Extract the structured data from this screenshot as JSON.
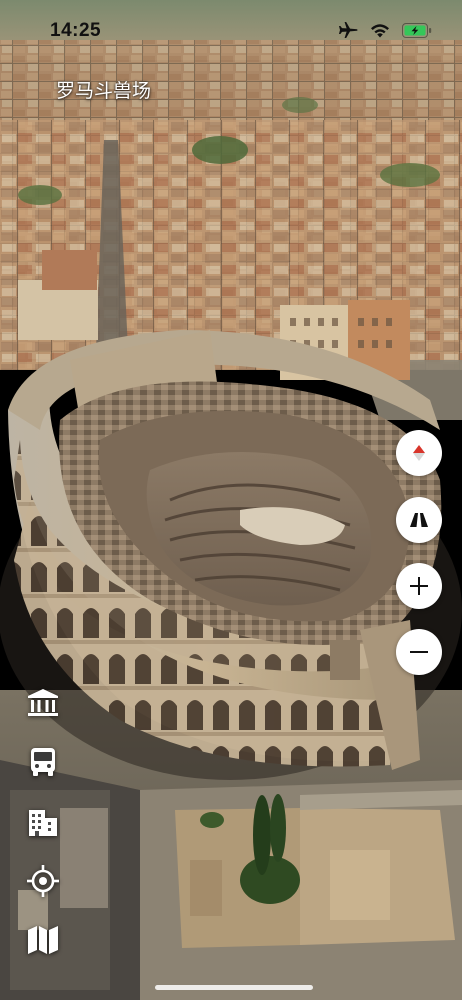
{
  "status_bar": {
    "time": "14:25",
    "icons": [
      "airplane-icon",
      "wifi-icon",
      "battery-charging-icon"
    ],
    "battery_color": "#34c759"
  },
  "map": {
    "place_label": "罗马斗兽场",
    "view": "3d-satellite"
  },
  "controls": {
    "right": [
      "compass-icon",
      "3d-view-icon",
      "zoom-in-icon",
      "zoom-out-icon"
    ],
    "left": [
      "museum-icon",
      "bus-icon",
      "building-icon",
      "location-icon",
      "map-icon"
    ]
  },
  "colors": {
    "compass_red": "#d8352b",
    "button_bg": "#ffffff",
    "icon_dark": "#111111"
  }
}
